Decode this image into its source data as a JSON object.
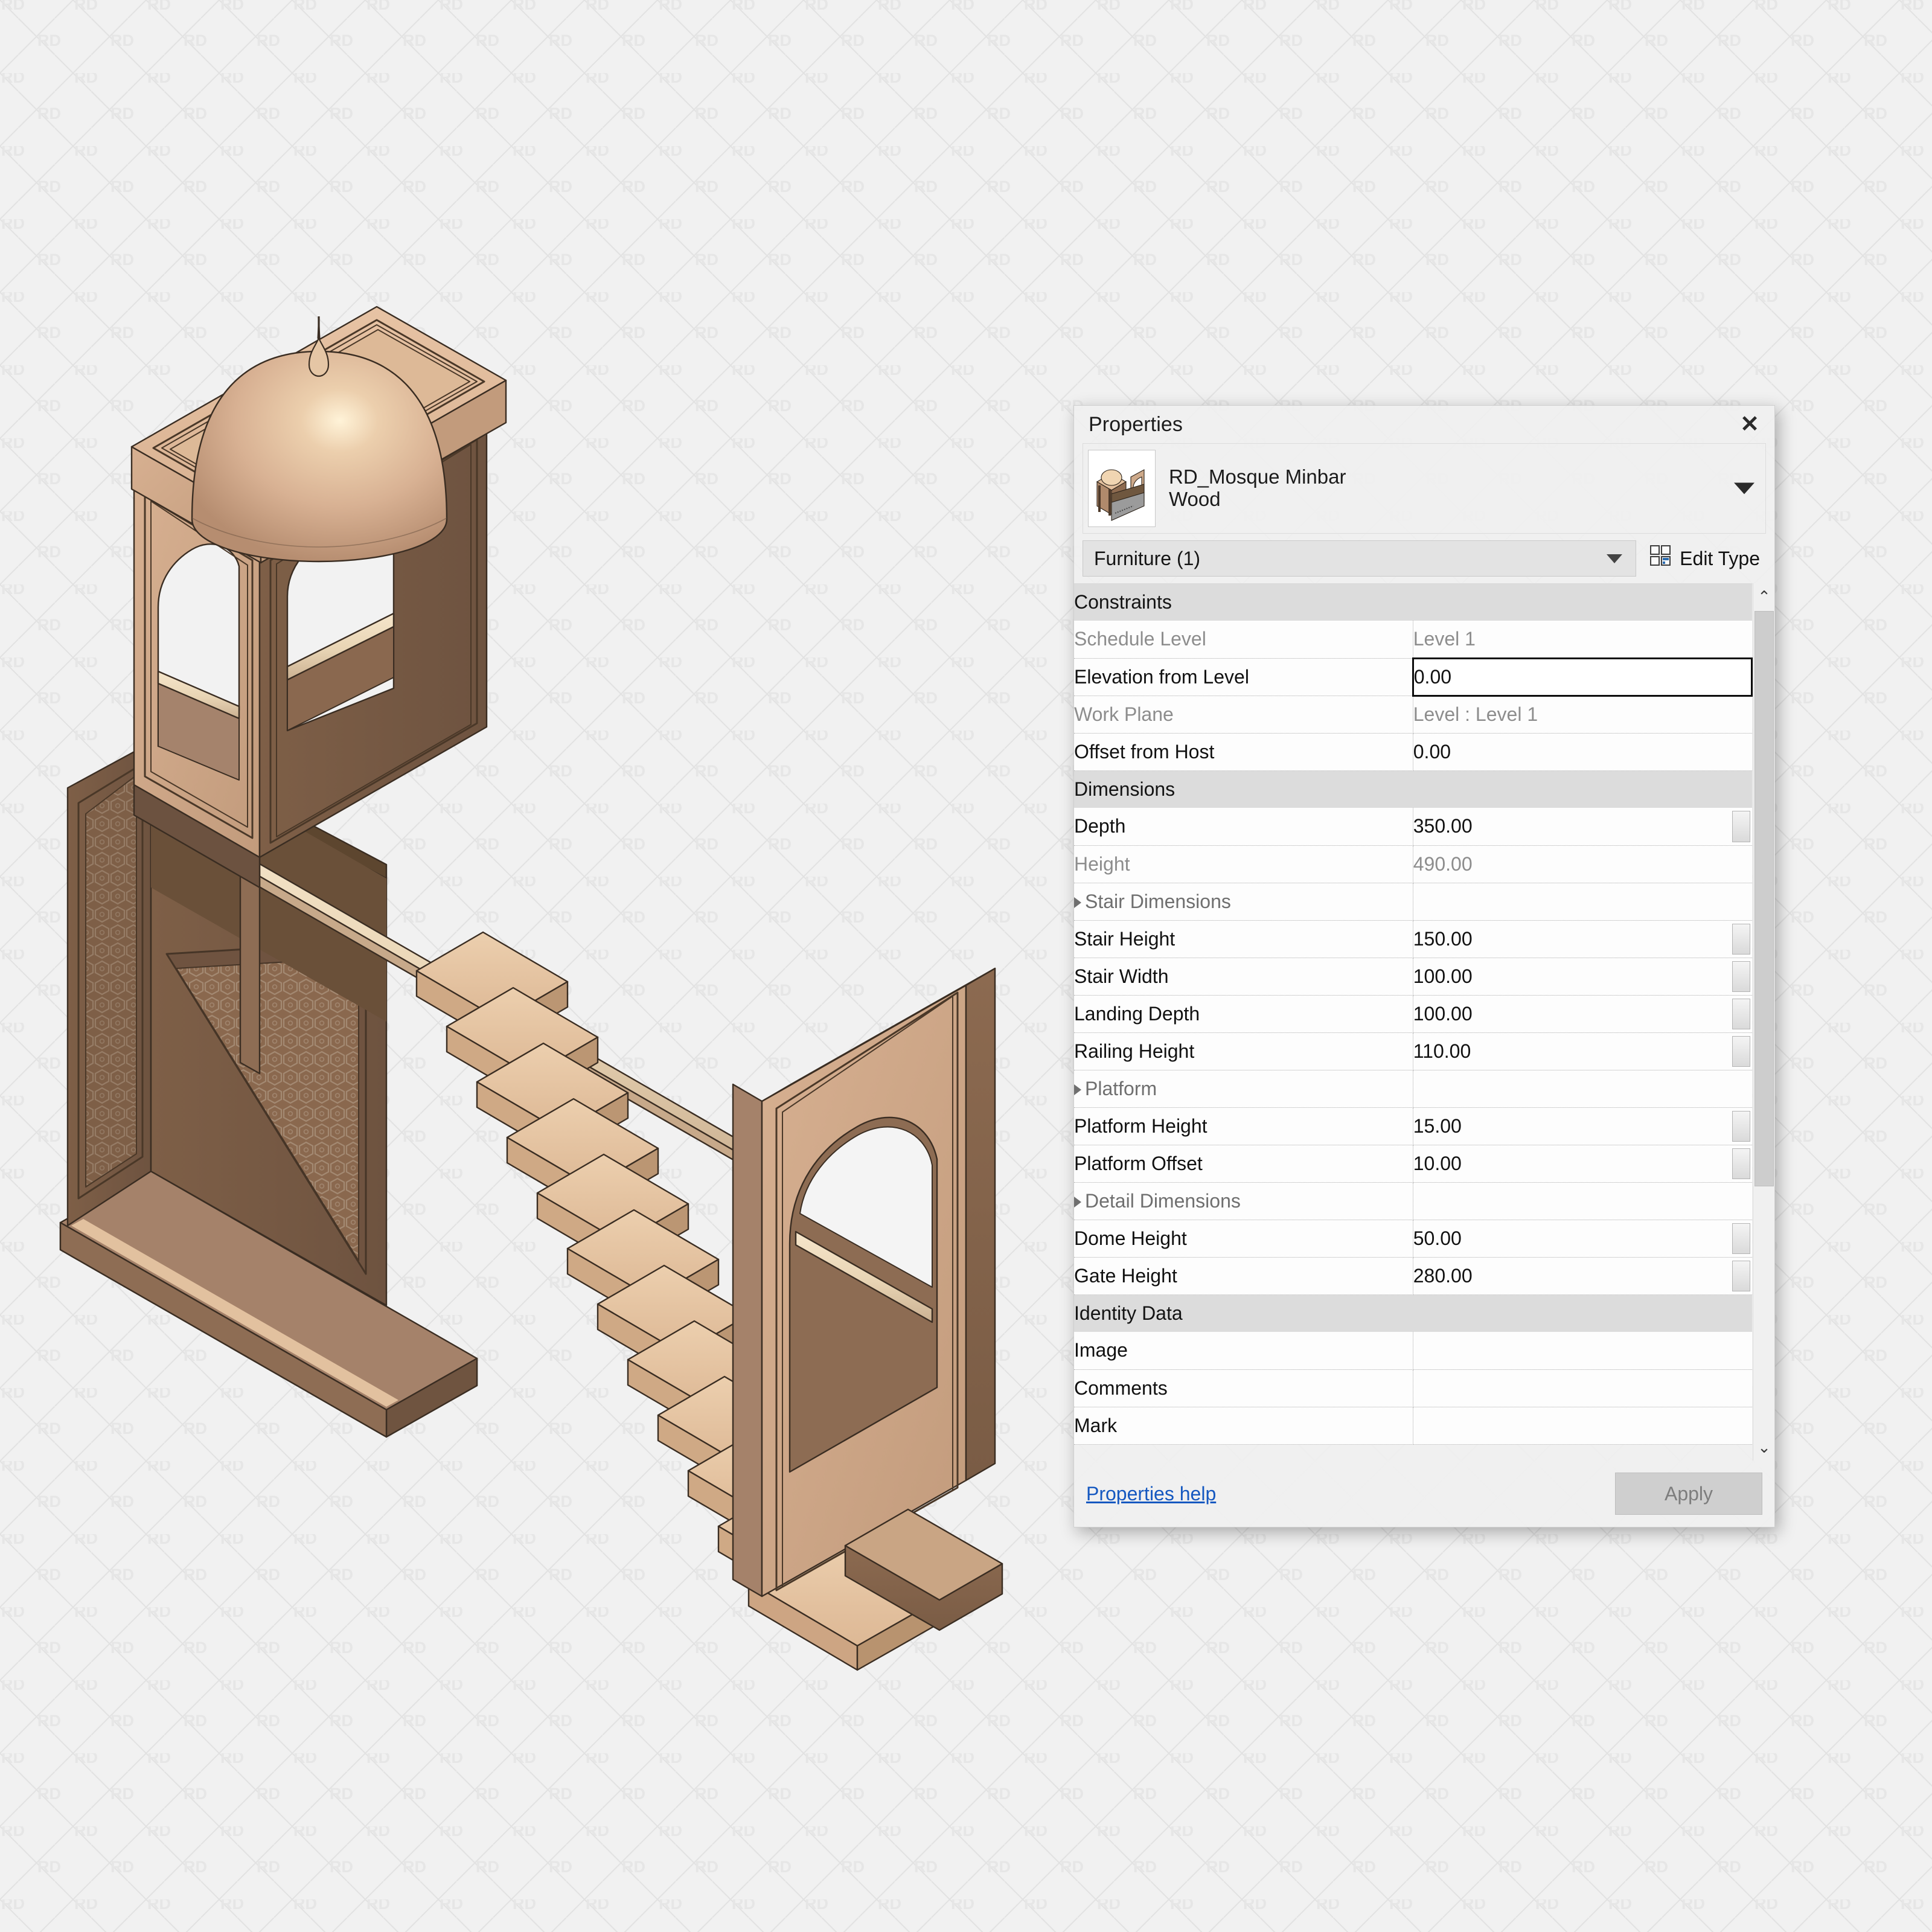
{
  "app": {
    "background_color": "#f1f1f1",
    "watermark_text": "RD"
  },
  "model": {
    "name": "RD_Mosque Minbar",
    "description": "Isometric 3D view of a wooden mosque minbar (pulpit) with a domed canopy, arched gate openings, latticed side panels, a staircase and a handrail."
  },
  "panel": {
    "title": "Properties",
    "close_icon": "✕",
    "type_header": {
      "family": "RD_Mosque Minbar",
      "type": "Wood",
      "dropdown_icon": "chevron-down-icon",
      "thumbnail_alt": "minbar-thumbnail"
    },
    "selector": {
      "category_value": "Furniture (1)",
      "dropdown_icon": "chevron-down-icon",
      "edit_type_label": "Edit Type",
      "edit_type_icon": "edit-type-icon"
    },
    "groups": [
      {
        "name": "Constraints",
        "collapse_icon": "⌃",
        "rows": [
          {
            "label": "Schedule Level",
            "value": "Level 1",
            "readonly": true,
            "editing": false,
            "spinner": false
          },
          {
            "label": "Elevation from Level",
            "value": "0.00",
            "readonly": false,
            "editing": true,
            "spinner": false
          },
          {
            "label": "Work Plane",
            "value": "Level : Level 1",
            "readonly": true,
            "editing": false,
            "spinner": false
          },
          {
            "label": "Offset from Host",
            "value": "0.00",
            "readonly": false,
            "editing": false,
            "spinner": false
          }
        ]
      },
      {
        "name": "Dimensions",
        "collapse_icon": "⌃",
        "rows": [
          {
            "label": "Depth",
            "value": "350.00",
            "readonly": false,
            "editing": false,
            "spinner": true
          },
          {
            "label": "Height",
            "value": "490.00",
            "readonly": true,
            "editing": false,
            "spinner": false
          },
          {
            "label": "Stair Dimensions",
            "value": "",
            "readonly": false,
            "editing": false,
            "spinner": false,
            "subgroup": true
          },
          {
            "label": "Stair Height",
            "value": "150.00",
            "readonly": false,
            "editing": false,
            "spinner": true
          },
          {
            "label": "Stair Width",
            "value": "100.00",
            "readonly": false,
            "editing": false,
            "spinner": true
          },
          {
            "label": "Landing Depth",
            "value": "100.00",
            "readonly": false,
            "editing": false,
            "spinner": true
          },
          {
            "label": "Railing Height",
            "value": "110.00",
            "readonly": false,
            "editing": false,
            "spinner": true
          },
          {
            "label": "Platform",
            "value": "",
            "readonly": false,
            "editing": false,
            "spinner": false,
            "subgroup": true
          },
          {
            "label": "Platform Height",
            "value": "15.00",
            "readonly": false,
            "editing": false,
            "spinner": true
          },
          {
            "label": "Platform Offset",
            "value": "10.00",
            "readonly": false,
            "editing": false,
            "spinner": true
          },
          {
            "label": "Detail Dimensions",
            "value": "",
            "readonly": false,
            "editing": false,
            "spinner": false,
            "subgroup": true
          },
          {
            "label": "Dome Height",
            "value": "50.00",
            "readonly": false,
            "editing": false,
            "spinner": true
          },
          {
            "label": "Gate Height",
            "value": "280.00",
            "readonly": false,
            "editing": false,
            "spinner": true
          }
        ]
      },
      {
        "name": "Identity Data",
        "collapse_icon": "⌃",
        "rows": [
          {
            "label": "Image",
            "value": "",
            "readonly": false,
            "editing": false,
            "spinner": false
          },
          {
            "label": "Comments",
            "value": "",
            "readonly": false,
            "editing": false,
            "spinner": false
          },
          {
            "label": "Mark",
            "value": "",
            "readonly": false,
            "editing": false,
            "spinner": false
          }
        ]
      }
    ],
    "scrollbar": {
      "up_icon": "⌃",
      "down_icon": "⌄"
    },
    "footer": {
      "help_link": "Properties help",
      "apply_label": "Apply"
    }
  }
}
